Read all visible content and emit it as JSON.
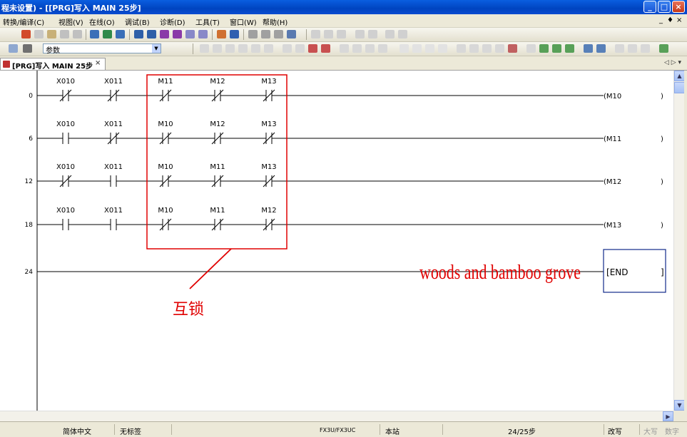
{
  "window": {
    "title": "程未设置) - [[PRG]写入 MAIN 25步]",
    "minimize": "_",
    "maximize": "□",
    "close": "×"
  },
  "menu": {
    "items": [
      "转换/编译(C)",
      "视图(V)",
      "在线(O)",
      "调试(B)",
      "诊断(D)",
      "工具(T)",
      "窗口(W)",
      "帮助(H)"
    ],
    "mdi_min": "_",
    "mdi_restore": "♦",
    "mdi_close": "×"
  },
  "toolbar": {
    "combo_value": "参数"
  },
  "tab": {
    "label": "[PRG]写入 MAIN 25步",
    "close": "×",
    "nav": "◁ ▷ ▾"
  },
  "ladder": {
    "rungs": [
      {
        "step": "0",
        "contacts": [
          {
            "label": "X010",
            "type": "nc"
          },
          {
            "label": "X011",
            "type": "nc"
          },
          {
            "label": "M11",
            "type": "nc"
          },
          {
            "label": "M12",
            "type": "nc"
          },
          {
            "label": "M13",
            "type": "nc"
          }
        ],
        "coil": "M10"
      },
      {
        "step": "6",
        "contacts": [
          {
            "label": "X010",
            "type": "no"
          },
          {
            "label": "X011",
            "type": "nc"
          },
          {
            "label": "M10",
            "type": "nc"
          },
          {
            "label": "M12",
            "type": "nc"
          },
          {
            "label": "M13",
            "type": "nc"
          }
        ],
        "coil": "M11"
      },
      {
        "step": "12",
        "contacts": [
          {
            "label": "X010",
            "type": "nc"
          },
          {
            "label": "X011",
            "type": "no"
          },
          {
            "label": "M10",
            "type": "nc"
          },
          {
            "label": "M11",
            "type": "nc"
          },
          {
            "label": "M13",
            "type": "nc"
          }
        ],
        "coil": "M12"
      },
      {
        "step": "18",
        "contacts": [
          {
            "label": "X010",
            "type": "no"
          },
          {
            "label": "X011",
            "type": "no"
          },
          {
            "label": "M10",
            "type": "nc"
          },
          {
            "label": "M11",
            "type": "nc"
          },
          {
            "label": "M12",
            "type": "nc"
          }
        ],
        "coil": "M13"
      }
    ],
    "end_step": "24",
    "end_label": "END"
  },
  "annotation": {
    "interlock_label": "互锁",
    "watermark": "woods and bamboo grove",
    "color": "#e00000"
  },
  "status": {
    "language": "简体中文",
    "label_status": "无标签",
    "plc_model": "FX3U/FX3UC",
    "station": "本站",
    "steps": "24/25步",
    "mode": "改写",
    "caps": "大写",
    "num": "数字"
  }
}
